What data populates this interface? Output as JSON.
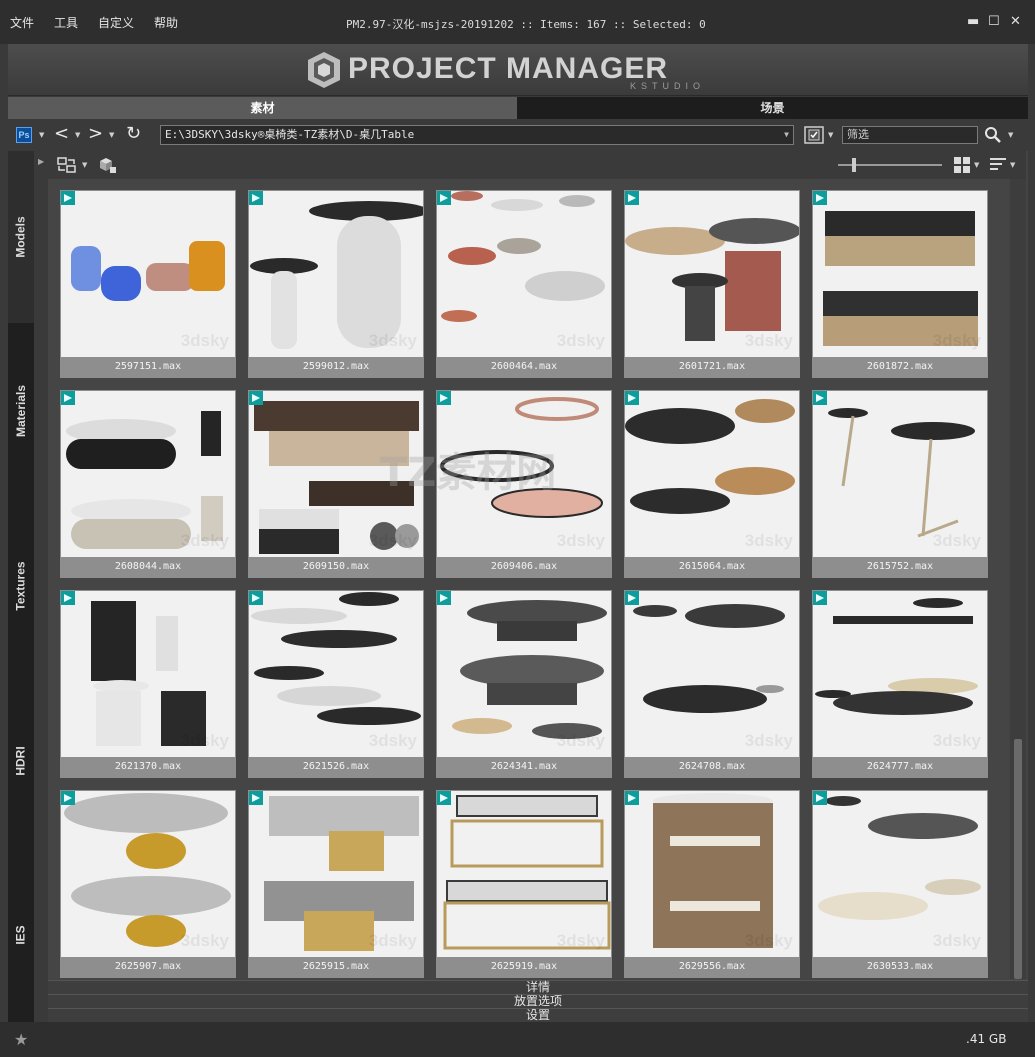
{
  "menu": {
    "items": [
      "文件",
      "工具",
      "自定义",
      "帮助"
    ]
  },
  "window": {
    "title": "PM2.97-汉化-msjzs-20191202  :: Items: 167  :: Selected: 0"
  },
  "banner": {
    "title": "PROJECT MANAGER",
    "subtitle": "KSTUDIO"
  },
  "tabs": [
    {
      "label": "素材",
      "active": true
    },
    {
      "label": "场景",
      "active": false
    }
  ],
  "toolbar": {
    "ps_label": "Ps",
    "path": "E:\\3DSKY\\3dsky®桌椅类-TZ素材\\D-桌几Table",
    "filter_placeholder": "筛选"
  },
  "sidebar": {
    "tabs": [
      {
        "label": "Models",
        "active": true
      },
      {
        "label": "Materials",
        "active": false
      },
      {
        "label": "Textures",
        "active": false
      },
      {
        "label": "HDRI",
        "active": false
      },
      {
        "label": "IES",
        "active": false
      }
    ]
  },
  "grid": {
    "items": [
      {
        "name": "2597151.max",
        "thumb": "vases"
      },
      {
        "name": "2599012.max",
        "thumb": "marble-pillar"
      },
      {
        "name": "2600464.max",
        "thumb": "trays"
      },
      {
        "name": "2601721.max",
        "thumb": "discs"
      },
      {
        "name": "2601872.max",
        "thumb": "box-tables"
      },
      {
        "name": "2608044.max",
        "thumb": "round-stack"
      },
      {
        "name": "2609150.max",
        "thumb": "marble-square"
      },
      {
        "name": "2609406.max",
        "thumb": "glass-oval"
      },
      {
        "name": "2615064.max",
        "thumb": "triangle-tables"
      },
      {
        "name": "2615752.max",
        "thumb": "side-table"
      },
      {
        "name": "2621370.max",
        "thumb": "pedestals"
      },
      {
        "name": "2621526.max",
        "thumb": "nesting-ovals"
      },
      {
        "name": "2624341.max",
        "thumb": "wood-ovals"
      },
      {
        "name": "2624708.max",
        "thumb": "black-marble-round"
      },
      {
        "name": "2624777.max",
        "thumb": "layered-round"
      },
      {
        "name": "2625907.max",
        "thumb": "gold-oval"
      },
      {
        "name": "2625915.max",
        "thumb": "acrylic-cube"
      },
      {
        "name": "2625919.max",
        "thumb": "brass-frame"
      },
      {
        "name": "2629556.max",
        "thumb": "wood-drum"
      },
      {
        "name": "2630533.max",
        "thumb": "stone-round"
      }
    ],
    "watermark": "3dsky"
  },
  "overlay_watermark": "TZ素材网",
  "sections": [
    "详情",
    "放置选项",
    "设置"
  ],
  "status": {
    "memory": ".41 GB"
  },
  "colors": {
    "accent": "#5b5b5b",
    "tab_inactive": "#1d1d1d",
    "panel": "#444444",
    "card": "#8e8e8e"
  }
}
